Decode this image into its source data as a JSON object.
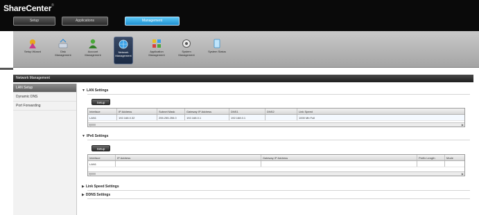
{
  "app": {
    "brand": "ShareCenter",
    "brand_sub": "®"
  },
  "top_tabs": [
    {
      "label": "Setup"
    },
    {
      "label": "Applications"
    },
    {
      "label": "Management"
    }
  ],
  "icon_bar": [
    {
      "label": "Setup Wizard",
      "icon": "wizard-icon"
    },
    {
      "label": "Disk Management",
      "icon": "disk-icon"
    },
    {
      "label": "Account Management",
      "icon": "accounts-icon"
    },
    {
      "label": "Network Management",
      "icon": "network-icon"
    },
    {
      "label": "Application Management",
      "icon": "apps-icon"
    },
    {
      "label": "System Management",
      "icon": "system-icon"
    },
    {
      "label": "System Status",
      "icon": "status-icon"
    }
  ],
  "page_title": "Network Management",
  "sidebar": {
    "items": [
      {
        "label": "LAN Setup"
      },
      {
        "label": "Dynamic DNS"
      },
      {
        "label": "Port Forwarding"
      }
    ]
  },
  "main": {
    "lan": {
      "title": "LAN Settings",
      "button": "Setup",
      "columns": [
        "Interface",
        "IP Address",
        "Subnet Mask",
        "Gateway IP Address",
        "DNS1",
        "DNS2",
        "Link Speed"
      ],
      "rows": [
        [
          "LAN1",
          "192.168.0.32",
          "255.255.255.0",
          "192.168.0.1",
          "192.168.0.1",
          "",
          "1000 Mb Full"
        ]
      ]
    },
    "ipv6": {
      "title": "IPv6 Settings",
      "button": "Setup",
      "columns": [
        "Interface",
        "IP Address",
        "Gateway IP Address",
        "Prefix Length",
        "Mode"
      ],
      "rows": [
        [
          "LAN1",
          "",
          "",
          "",
          ""
        ]
      ]
    },
    "link_speed": {
      "title": "Link Speed Settings"
    },
    "ddns": {
      "title": "DDNS Settings"
    }
  }
}
